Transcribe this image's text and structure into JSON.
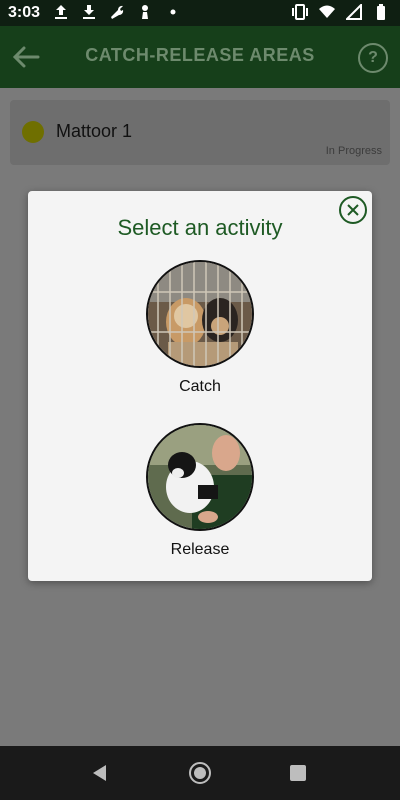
{
  "status_bar": {
    "time": "3:03",
    "left_icons": [
      "upload-icon",
      "download-icon",
      "wrench-icon",
      "chess-pawn-icon",
      "dot-icon"
    ],
    "right_icons": [
      "vibrate-icon",
      "wifi-icon",
      "cellular-signal-icon",
      "battery-icon"
    ]
  },
  "app_bar": {
    "title": "CATCH-RELEASE AREAS",
    "back_icon": "back-arrow-icon",
    "help_glyph": "?"
  },
  "areas": [
    {
      "name": "Mattoor 1",
      "status": "In Progress",
      "dot_color": "#6f6f00"
    }
  ],
  "modal": {
    "title": "Select an activity",
    "close_icon": "close-icon",
    "activities": [
      {
        "label": "Catch",
        "image": "puppies-in-cage-photo"
      },
      {
        "label": "Release",
        "image": "man-holding-dog-photo"
      }
    ]
  },
  "nav_bar": {
    "buttons": [
      "back-triangle-icon",
      "home-circle-icon",
      "recents-square-icon"
    ]
  },
  "colors": {
    "app_bar_bg": "#163f1a",
    "status_bar_bg": "#0f1f12",
    "accent_green": "#1e5a24",
    "overlay_gray": "#7a7a7a"
  }
}
